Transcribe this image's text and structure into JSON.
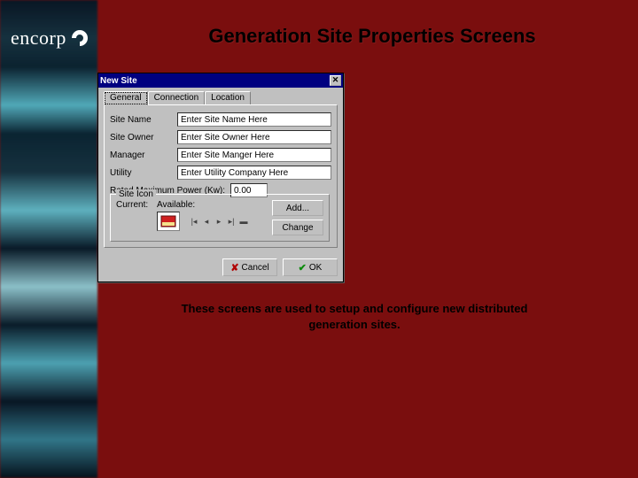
{
  "brand": {
    "name": "encorp"
  },
  "slide": {
    "title": "Generation Site Properties Screens",
    "caption": "These screens are used to setup and configure new distributed generation sites."
  },
  "dialog": {
    "title": "New Site",
    "close_glyph": "✕",
    "tabs": [
      {
        "label": "General",
        "active": true
      },
      {
        "label": "Connection",
        "active": false
      },
      {
        "label": "Location",
        "active": false
      }
    ],
    "fields": {
      "site_name": {
        "label": "Site Name",
        "value": "Enter Site Name Here"
      },
      "site_owner": {
        "label": "Site Owner",
        "value": "Enter Site Owner Here"
      },
      "manager": {
        "label": "Manager",
        "value": "Enter Site Manger Here"
      },
      "utility": {
        "label": "Utility",
        "value": "Enter Utility Company Here"
      },
      "rated": {
        "label": "Rated Maximum Power (Kw):",
        "value": "0.00"
      }
    },
    "icon_group": {
      "legend": "Site Icon",
      "current_label": "Current:",
      "available_label": "Available:",
      "nav": {
        "first": "|◂",
        "prev": "◂",
        "next": "▸",
        "last": "▸|",
        "stop": "▬"
      },
      "buttons": {
        "add": "Add...",
        "change": "Change"
      }
    },
    "footer": {
      "cancel": {
        "glyph": "✘",
        "label": "Cancel"
      },
      "ok": {
        "glyph": "✔",
        "label": "OK"
      }
    }
  }
}
